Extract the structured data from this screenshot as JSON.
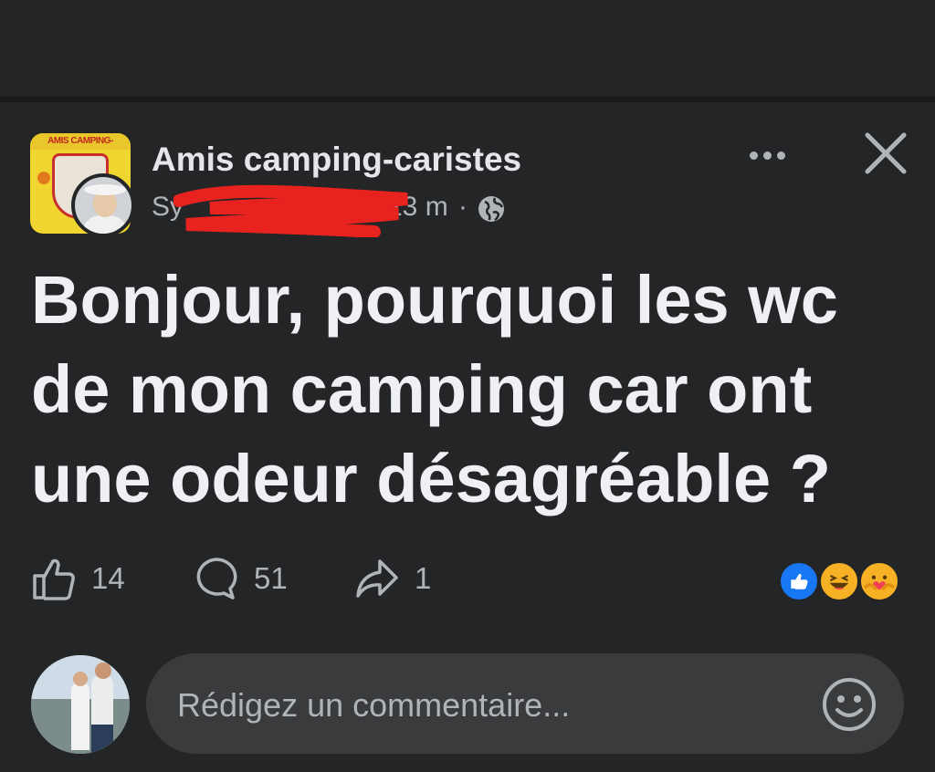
{
  "post": {
    "group_name": "Amis camping-caristes",
    "group_logo_text": "AMIS CAMPING-CARISTES",
    "author": "Sy",
    "time": "23 m",
    "separator": "·",
    "visibility_icon": "globe-icon",
    "more_icon": "more-icon",
    "close_icon": "close-icon",
    "text": "Bonjour, pourquoi les wc de mon camping car ont une odeur désagréable ?",
    "likes_count": "14",
    "comments_count": "51",
    "shares_count": "1",
    "reaction_icons": [
      "like-reaction-icon",
      "haha-reaction-icon",
      "care-reaction-icon"
    ],
    "colors": {
      "background": "#242526",
      "text": "#e4e6eb",
      "secondary_text": "#b0b3b8",
      "input_bg": "#3a3b3c",
      "like_blue": "#1877f2",
      "redaction": "#e8231f"
    }
  },
  "composer": {
    "placeholder": "Rédigez un commentaire...",
    "emoji_icon": "emoji-icon"
  }
}
